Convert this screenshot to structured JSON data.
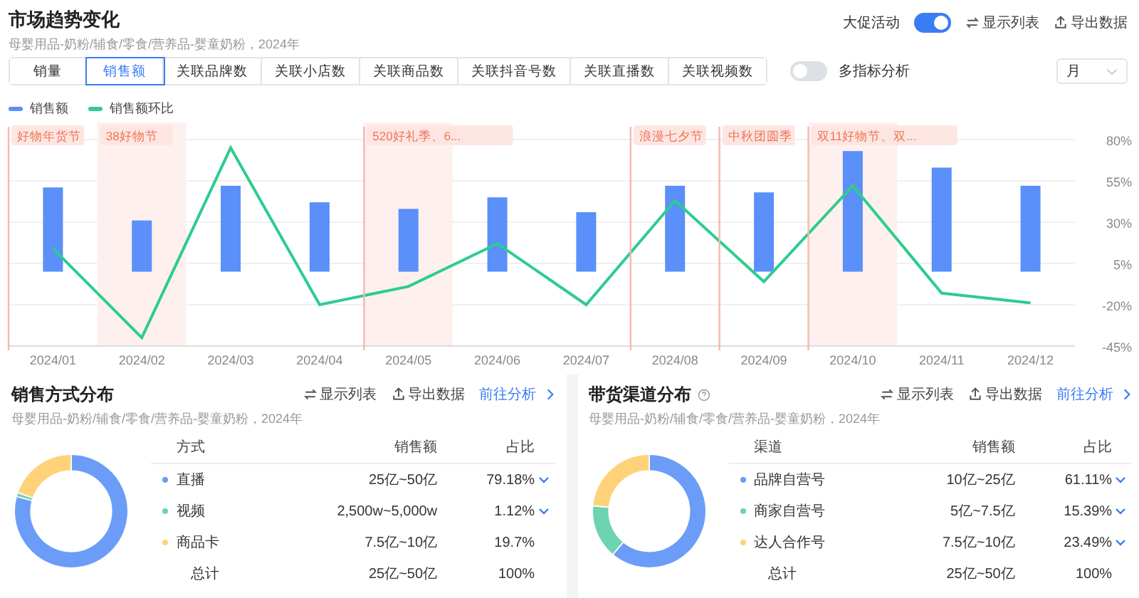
{
  "header": {
    "title": "市场趋势变化",
    "subtitle": "母婴用品-奶粉/辅食/零食/营养品-婴童奶粉，2024年",
    "promo_toggle": {
      "label": "大促活动",
      "on": true
    },
    "actions": [
      {
        "kind": "list",
        "label": "显示列表"
      },
      {
        "kind": "export",
        "label": "导出数据"
      }
    ]
  },
  "tabs": [
    {
      "label": "销量",
      "selected": false
    },
    {
      "label": "销售额",
      "selected": true
    },
    {
      "label": "关联品牌数",
      "selected": false
    },
    {
      "label": "关联小店数",
      "selected": false
    },
    {
      "label": "关联商品数",
      "selected": false
    },
    {
      "label": "关联抖音号数",
      "selected": false
    },
    {
      "label": "关联直播数",
      "selected": false
    },
    {
      "label": "关联视频数",
      "selected": false
    }
  ],
  "multi_toggle": {
    "label": "多指标分析",
    "on": false
  },
  "period_select": {
    "value": "月"
  },
  "chart_data": {
    "type": "bar",
    "categories": [
      "2024/01",
      "2024/02",
      "2024/03",
      "2024/04",
      "2024/05",
      "2024/06",
      "2024/07",
      "2024/08",
      "2024/09",
      "2024/10",
      "2024/11",
      "2024/12"
    ],
    "series": [
      {
        "name": "销售额",
        "color": "#5b8ff9",
        "type": "bar",
        "values": [
          51,
          31,
          52,
          42,
          38,
          45,
          36,
          52,
          48,
          73,
          63,
          52
        ]
      },
      {
        "name": "销售额环比",
        "color": "#2ecc8f",
        "type": "line",
        "values": [
          14,
          -40,
          75,
          -20,
          -9,
          17,
          -20,
          43,
          -6,
          52,
          -13,
          -19
        ]
      }
    ],
    "ylim": [
      -45,
      80
    ],
    "yticks": [
      {
        "value": 80,
        "label": "80%"
      },
      {
        "value": 55,
        "label": "55%"
      },
      {
        "value": 30,
        "label": "30%"
      },
      {
        "value": 5,
        "label": "5%"
      },
      {
        "value": -20,
        "label": "-20%"
      },
      {
        "value": -45,
        "label": "-45%"
      }
    ],
    "grid": true
  },
  "month_events": [
    {
      "tag": "好物年货节",
      "line": true,
      "band": false
    },
    {
      "tag": "38好物节",
      "line": false,
      "band": true
    },
    {
      "line": false,
      "band": false
    },
    {
      "line": false,
      "band": false
    },
    {
      "tag": "520好礼季、6...",
      "line": true,
      "band": true
    },
    {
      "line": false,
      "band": false
    },
    {
      "line": false,
      "band": false
    },
    {
      "tag": "浪漫七夕节",
      "line": true,
      "band": false
    },
    {
      "tag": "中秋团圆季",
      "line": true,
      "band": false
    },
    {
      "tag": "双11好物节、双...",
      "line": true,
      "band": true
    },
    {
      "line": false,
      "band": false
    },
    {
      "line": false,
      "band": false
    }
  ],
  "cards": [
    {
      "title": "销售方式分布",
      "help": false,
      "subtitle": "母婴用品-奶粉/辅食/零食/营养品-婴童奶粉，2024年",
      "actions": [
        {
          "kind": "list",
          "label": "显示列表"
        },
        {
          "kind": "export",
          "label": "导出数据"
        },
        {
          "kind": "link",
          "label": "前往分析"
        }
      ],
      "columns": [
        "方式",
        "销售额",
        "占比"
      ],
      "chart_data": {
        "type": "donut",
        "values": [
          79.18,
          1.12,
          19.7
        ]
      },
      "rows": [
        {
          "name": "直播",
          "color": "#6b9cf7",
          "sales": "25亿~50亿",
          "share": "79.18%",
          "expandable": true
        },
        {
          "name": "视频",
          "color": "#6dd3b0",
          "sales": "2,500w~5,000w",
          "share": "1.12%",
          "expandable": true
        },
        {
          "name": "商品卡",
          "color": "#ffd27a",
          "sales": "7.5亿~10亿",
          "share": "19.7%",
          "expandable": false
        }
      ],
      "total": {
        "name": "总计",
        "sales": "25亿~50亿",
        "share": "100%"
      }
    },
    {
      "title": "带货渠道分布",
      "help": true,
      "subtitle": "母婴用品-奶粉/辅食/零食/营养品-婴童奶粉，2024年",
      "actions": [
        {
          "kind": "list",
          "label": "显示列表"
        },
        {
          "kind": "export",
          "label": "导出数据"
        },
        {
          "kind": "link",
          "label": "前往分析"
        }
      ],
      "columns": [
        "渠道",
        "销售额",
        "占比"
      ],
      "chart_data": {
        "type": "donut",
        "values": [
          61.11,
          15.39,
          23.49
        ]
      },
      "rows": [
        {
          "name": "品牌自营号",
          "color": "#6b9cf7",
          "sales": "10亿~25亿",
          "share": "61.11%",
          "expandable": true
        },
        {
          "name": "商家自营号",
          "color": "#6dd3b0",
          "sales": "5亿~7.5亿",
          "share": "15.39%",
          "expandable": true
        },
        {
          "name": "达人合作号",
          "color": "#ffd27a",
          "sales": "7.5亿~10亿",
          "share": "23.49%",
          "expandable": true
        }
      ],
      "total": {
        "name": "总计",
        "sales": "25亿~50亿",
        "share": "100%"
      }
    }
  ]
}
